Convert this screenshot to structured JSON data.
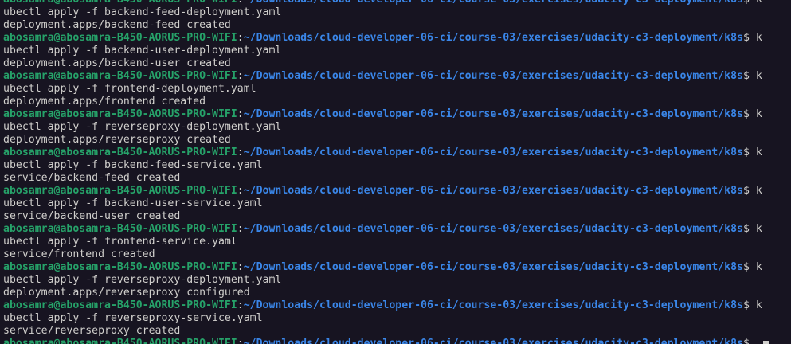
{
  "terminal": {
    "background": "#171421",
    "colors": {
      "user_host": "#26a269",
      "path": "#3a86e8",
      "text": "#d0cfcc"
    },
    "prompt": {
      "user_host": "abosamra@abosamra-B450-AORUS-PRO-WIFI",
      "sep": ":",
      "path": "~/Downloads/cloud-developer-06-ci/course-03/exercises/udacity-c3-deployment/k8s",
      "suffix": "$ k"
    },
    "entries": [
      {
        "command": "ubectl apply -f backend-feed-deployment.yaml",
        "output": "deployment.apps/backend-feed created"
      },
      {
        "command": "ubectl apply -f backend-user-deployment.yaml",
        "output": "deployment.apps/backend-user created"
      },
      {
        "command": "ubectl apply -f frontend-deployment.yaml",
        "output": "deployment.apps/frontend created"
      },
      {
        "command": "ubectl apply -f reverseproxy-deployment.yaml",
        "output": "deployment.apps/reverseproxy created"
      },
      {
        "command": "ubectl apply -f backend-feed-service.yaml",
        "output": "service/backend-feed created"
      },
      {
        "command": "ubectl apply -f backend-user-service.yaml",
        "output": "service/backend-user created"
      },
      {
        "command": "ubectl apply -f frontend-service.yaml",
        "output": "service/frontend created"
      },
      {
        "command": "ubectl apply -f reverseproxy-deployment.yaml",
        "output": "deployment.apps/reverseproxy configured"
      },
      {
        "command": "ubectl apply -f reverseproxy-service.yaml",
        "output": "service/reverseproxy created"
      }
    ],
    "last_prompt": {
      "user_host": "abosamra@abosamra-B450-AORUS-PRO-WIFI",
      "sep": ":",
      "path": "~/Downloads/cloud-developer-06-ci/course-03/exercises/udacity-c3-deployment/k8s",
      "suffix": "$"
    }
  }
}
